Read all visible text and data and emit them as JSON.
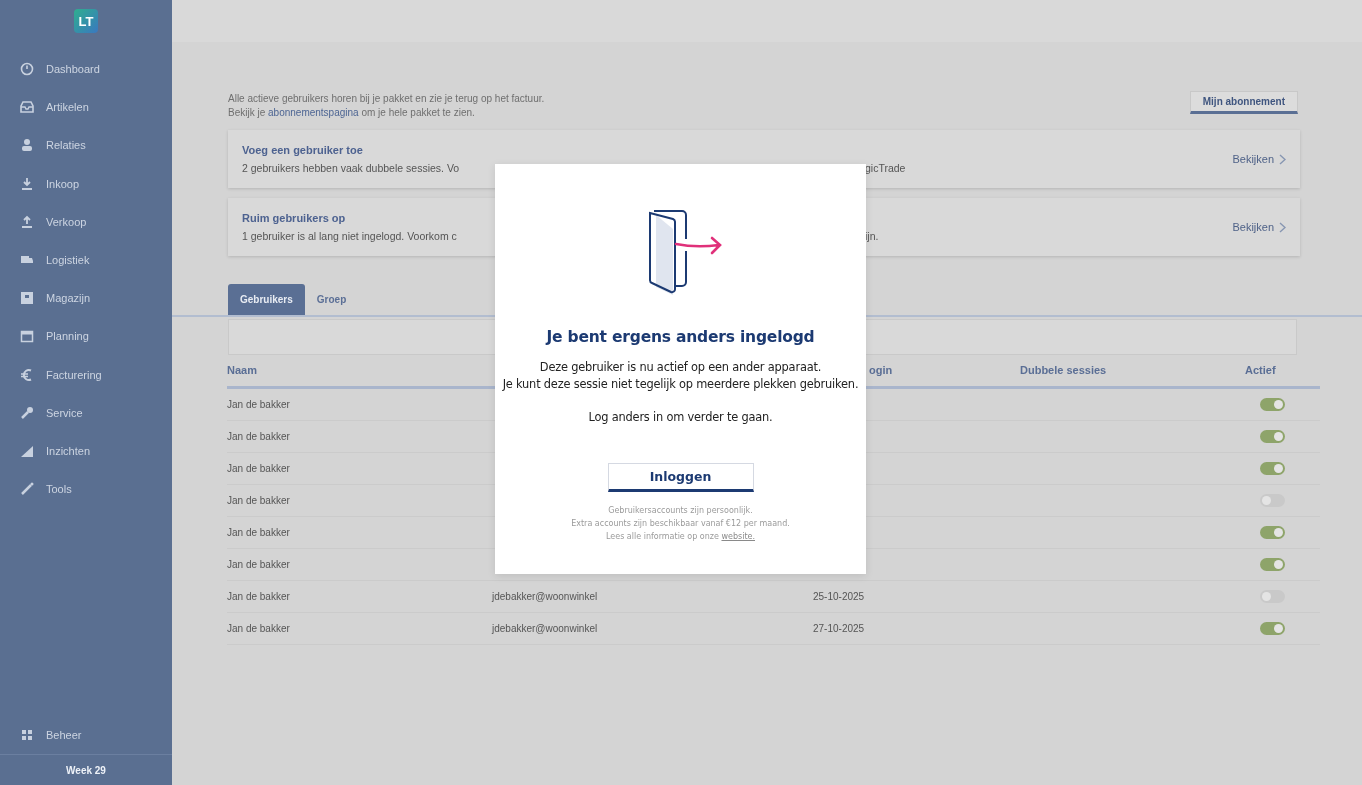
{
  "sidebar": {
    "logo": "LT",
    "items": [
      {
        "label": "Dashboard",
        "kind": "dashboard"
      },
      {
        "label": "Artikelen",
        "kind": "inbox"
      },
      {
        "label": "Relaties",
        "kind": "person"
      },
      {
        "label": "Inkoop",
        "kind": "download"
      },
      {
        "label": "Verkoop",
        "kind": "upload"
      },
      {
        "label": "Logistiek",
        "kind": "truck"
      },
      {
        "label": "Magazijn",
        "kind": "box"
      },
      {
        "label": "Planning",
        "kind": "calendar"
      },
      {
        "label": "Facturering",
        "kind": "euro"
      },
      {
        "label": "Service",
        "kind": "wrench"
      },
      {
        "label": "Inzichten",
        "kind": "chart"
      },
      {
        "label": "Tools",
        "kind": "wand"
      }
    ],
    "bottom_item": {
      "label": "Beheer",
      "kind": "grid"
    },
    "week": "Week 29"
  },
  "intro": {
    "line_1": "Alle actieve gebruikers horen bij je pakket en zie je terug op het factuur.",
    "line_2_before": "Bekijk je ",
    "line_2_link": "abonnementspagina",
    "line_2_after": " om je hele pakket te zien."
  },
  "subscription_button": "Mijn abonnement",
  "cards": [
    {
      "title": "Voeg een gebruiker toe",
      "text_start": "2 gebruikers hebben vaak dubbele sessies. Vo",
      "text_end": "gicTrade",
      "action": "Bekijken"
    },
    {
      "title": "Ruim gebruikers op",
      "text_start": "1 gebruiker is al lang niet ingelogd. Voorkom c",
      "text_end": "ijn.",
      "action": "Bekijken"
    }
  ],
  "tabs": [
    {
      "label": "Gebruikers",
      "selected": true
    },
    {
      "label": "Groep",
      "selected": false
    }
  ],
  "table": {
    "columns": {
      "naam": "Naam",
      "column_3": "ogin",
      "dubbele_sessies": "Dubbele sessies",
      "actief": "Actief"
    },
    "rows": [
      {
        "name": "Jan de bakker",
        "active": true
      },
      {
        "name": "Jan de bakker",
        "active": true
      },
      {
        "name": "Jan de bakker",
        "active": true
      },
      {
        "name": "Jan de bakker",
        "active": false
      },
      {
        "name": "Jan de bakker",
        "active": true
      },
      {
        "name": "Jan de bakker",
        "active": true
      },
      {
        "name": "Jan de bakker",
        "email": "jdebakker@woonwinkel",
        "date": "25-10-2025",
        "active": false
      },
      {
        "name": "Jan de bakker",
        "email": "jdebakker@woonwinkel",
        "date": "27-10-2025",
        "active": true
      }
    ]
  },
  "modal": {
    "title": "Je bent ergens anders ingelogd",
    "message_lines": [
      "Deze gebruiker is nu actief op een ander apparaat.",
      "Je kunt deze sessie niet tegelijk op meerdere plekken gebruiken."
    ],
    "instruction": "Log anders in om verder te gaan.",
    "button": "Inloggen",
    "footer_lines": [
      "Gebruikersaccounts zijn persoonlijk.",
      "Extra accounts zijn beschikbaar vanaf €12 per maand."
    ],
    "footer_before": "Lees alle informatie op onze ",
    "footer_link": "website."
  }
}
